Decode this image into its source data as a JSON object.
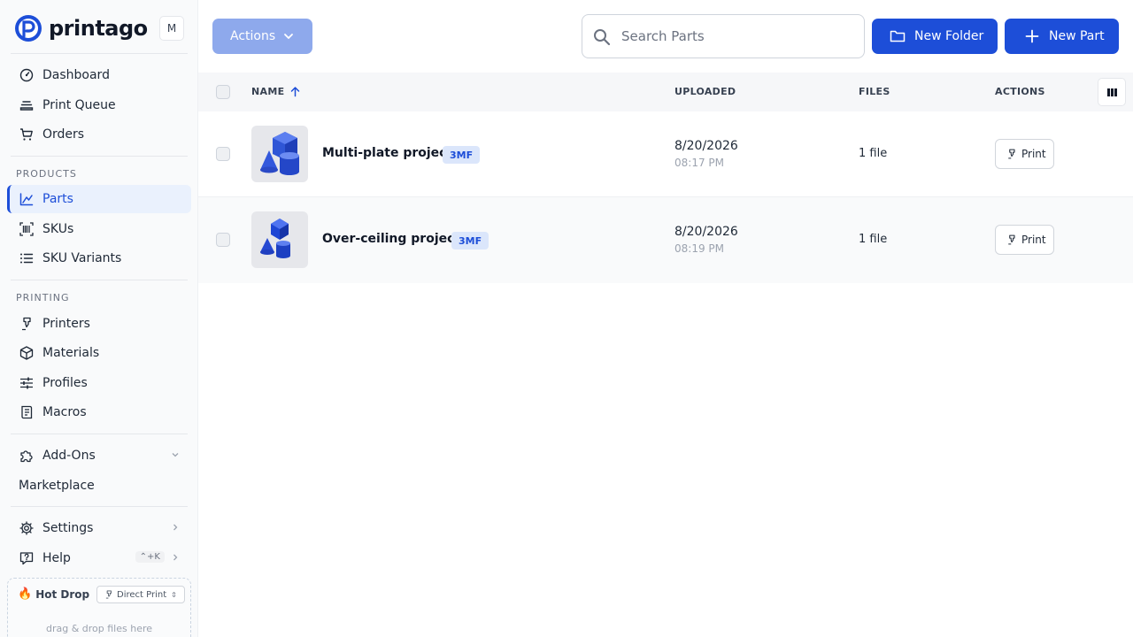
{
  "sidebar": {
    "brand": "printago",
    "workspace_initial": "M",
    "nav_main": [
      {
        "label": "Dashboard",
        "icon": "dashboard-icon"
      },
      {
        "label": "Print Queue",
        "icon": "print-queue-icon"
      },
      {
        "label": "Orders",
        "icon": "cart-icon"
      }
    ],
    "products_label": "PRODUCTS",
    "nav_products": [
      {
        "label": "Parts",
        "icon": "parts-icon",
        "active": true
      },
      {
        "label": "SKUs",
        "icon": "barcode-icon"
      },
      {
        "label": "SKU Variants",
        "icon": "list-icon"
      }
    ],
    "printing_label": "PRINTING",
    "nav_printing": [
      {
        "label": "Printers",
        "icon": "printer-nozzle-icon"
      },
      {
        "label": "Materials",
        "icon": "cube-icon"
      },
      {
        "label": "Profiles",
        "icon": "sliders-icon"
      },
      {
        "label": "Macros",
        "icon": "macro-icon"
      }
    ],
    "addons_label": "Add-Ons",
    "marketplace_label": "Marketplace",
    "settings_label": "Settings",
    "help_label": "Help",
    "help_shortcut": "⌃+K",
    "hotdrop": {
      "title": "Hot Drop",
      "mode": "Direct Print",
      "hint": "drag & drop files here"
    }
  },
  "toolbar": {
    "actions_label": "Actions",
    "search_placeholder": "Search Parts",
    "search_value": "",
    "new_folder_label": "New Folder",
    "new_part_label": "New Part"
  },
  "table": {
    "columns": {
      "name": "NAME",
      "uploaded": "UPLOADED",
      "files": "FILES",
      "actions": "ACTIONS"
    },
    "rows": [
      {
        "name": "Multi-plate project",
        "badge": "3MF",
        "date": "8/20/2026",
        "time": "08:17 PM",
        "files": "1 file",
        "action": "Print"
      },
      {
        "name": "Over-ceiling project",
        "badge": "3MF",
        "date": "8/20/2026",
        "time": "08:19 PM",
        "files": "1 file",
        "action": "Print"
      }
    ]
  },
  "colors": {
    "primary": "#1d4ed8",
    "primary_disabled": "#8ea9ec",
    "active_bg": "#eaf1fd",
    "badge_bg": "#dbe6fb"
  }
}
